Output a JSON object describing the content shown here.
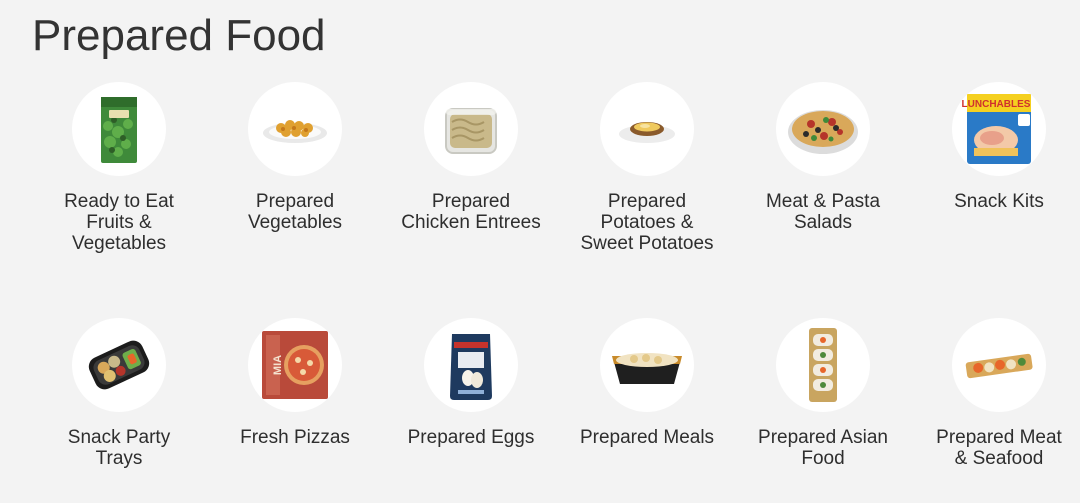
{
  "page": {
    "title": "Prepared Food"
  },
  "categories": [
    {
      "label": "Ready to Eat Fruits & Vegetables",
      "icon": "salad-bag-icon"
    },
    {
      "label": "Prepared Vegetables",
      "icon": "vegetable-plate-icon"
    },
    {
      "label": "Prepared Chicken Entrees",
      "icon": "chicken-container-icon"
    },
    {
      "label": "Prepared Potatoes & Sweet Potatoes",
      "icon": "stuffed-potato-icon"
    },
    {
      "label": "Meat & Pasta Salads",
      "icon": "pasta-salad-bowl-icon"
    },
    {
      "label": "Snack Kits",
      "icon": "lunchables-box-icon"
    },
    {
      "label": "Snack Party Trays",
      "icon": "party-tray-icon"
    },
    {
      "label": "Fresh Pizzas",
      "icon": "pizza-box-icon"
    },
    {
      "label": "Prepared Eggs",
      "icon": "egg-pouch-icon"
    },
    {
      "label": "Prepared Meals",
      "icon": "meal-tray-icon"
    },
    {
      "label": "Prepared Asian Food",
      "icon": "sushi-tray-icon"
    },
    {
      "label": "Prepared Meat & Seafood",
      "icon": "seafood-skewer-icon"
    }
  ],
  "brand_logo_text": {
    "snack_kit": "LUNCHABLES",
    "pizza": "MIA"
  }
}
